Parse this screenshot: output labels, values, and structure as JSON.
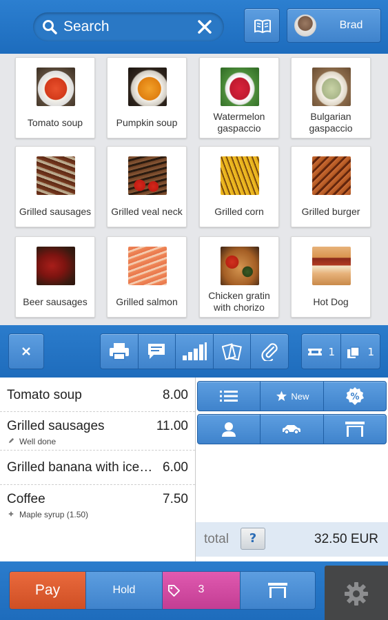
{
  "search": {
    "placeholder": "Search"
  },
  "user": {
    "name": "Brad"
  },
  "products": [
    {
      "label": "Tomato soup",
      "icon": "tomato-soup-photo"
    },
    {
      "label": "Pumpkin soup",
      "icon": "pumpkin-soup-photo"
    },
    {
      "label": "Watermelon gaspaccio",
      "icon": "watermelon-gaspaccio-photo"
    },
    {
      "label": "Bulgarian gaspaccio",
      "icon": "bulgarian-gaspaccio-photo"
    },
    {
      "label": "Grilled sausages",
      "icon": "grilled-sausages-photo"
    },
    {
      "label": "Grilled veal neck",
      "icon": "grilled-veal-neck-photo"
    },
    {
      "label": "Grilled corn",
      "icon": "grilled-corn-photo"
    },
    {
      "label": "Grilled burger",
      "icon": "grilled-burger-photo"
    },
    {
      "label": "Beer sausages",
      "icon": "beer-sausages-photo"
    },
    {
      "label": "Grilled salmon",
      "icon": "grilled-salmon-photo"
    },
    {
      "label": "Chicken gratin with chorizo",
      "icon": "chicken-gratin-photo"
    },
    {
      "label": "Hot Dog",
      "icon": "hot-dog-photo"
    }
  ],
  "toolbar": {
    "ticket_count": "1",
    "copy_count": "1"
  },
  "order": {
    "items": [
      {
        "name": "Tomato soup",
        "price": "8.00",
        "modifier": ""
      },
      {
        "name": "Grilled sausages",
        "price": "11.00",
        "modifier": "Well done"
      },
      {
        "name": "Grilled banana with ice…",
        "price": "6.00",
        "modifier": ""
      },
      {
        "name": "Coffee",
        "price": "7.50",
        "modifier": "Maple syrup (1.50)"
      }
    ]
  },
  "actions": {
    "new_label": "New"
  },
  "total": {
    "label": "total",
    "help": "?",
    "value": "32.50 EUR"
  },
  "bottom": {
    "pay": "Pay",
    "hold": "Hold",
    "tag_count": "3"
  },
  "colors": {
    "primary": "#1e6cbc",
    "pay": "#d9552a",
    "tags": "#d24aa3",
    "settings": "#454647"
  }
}
